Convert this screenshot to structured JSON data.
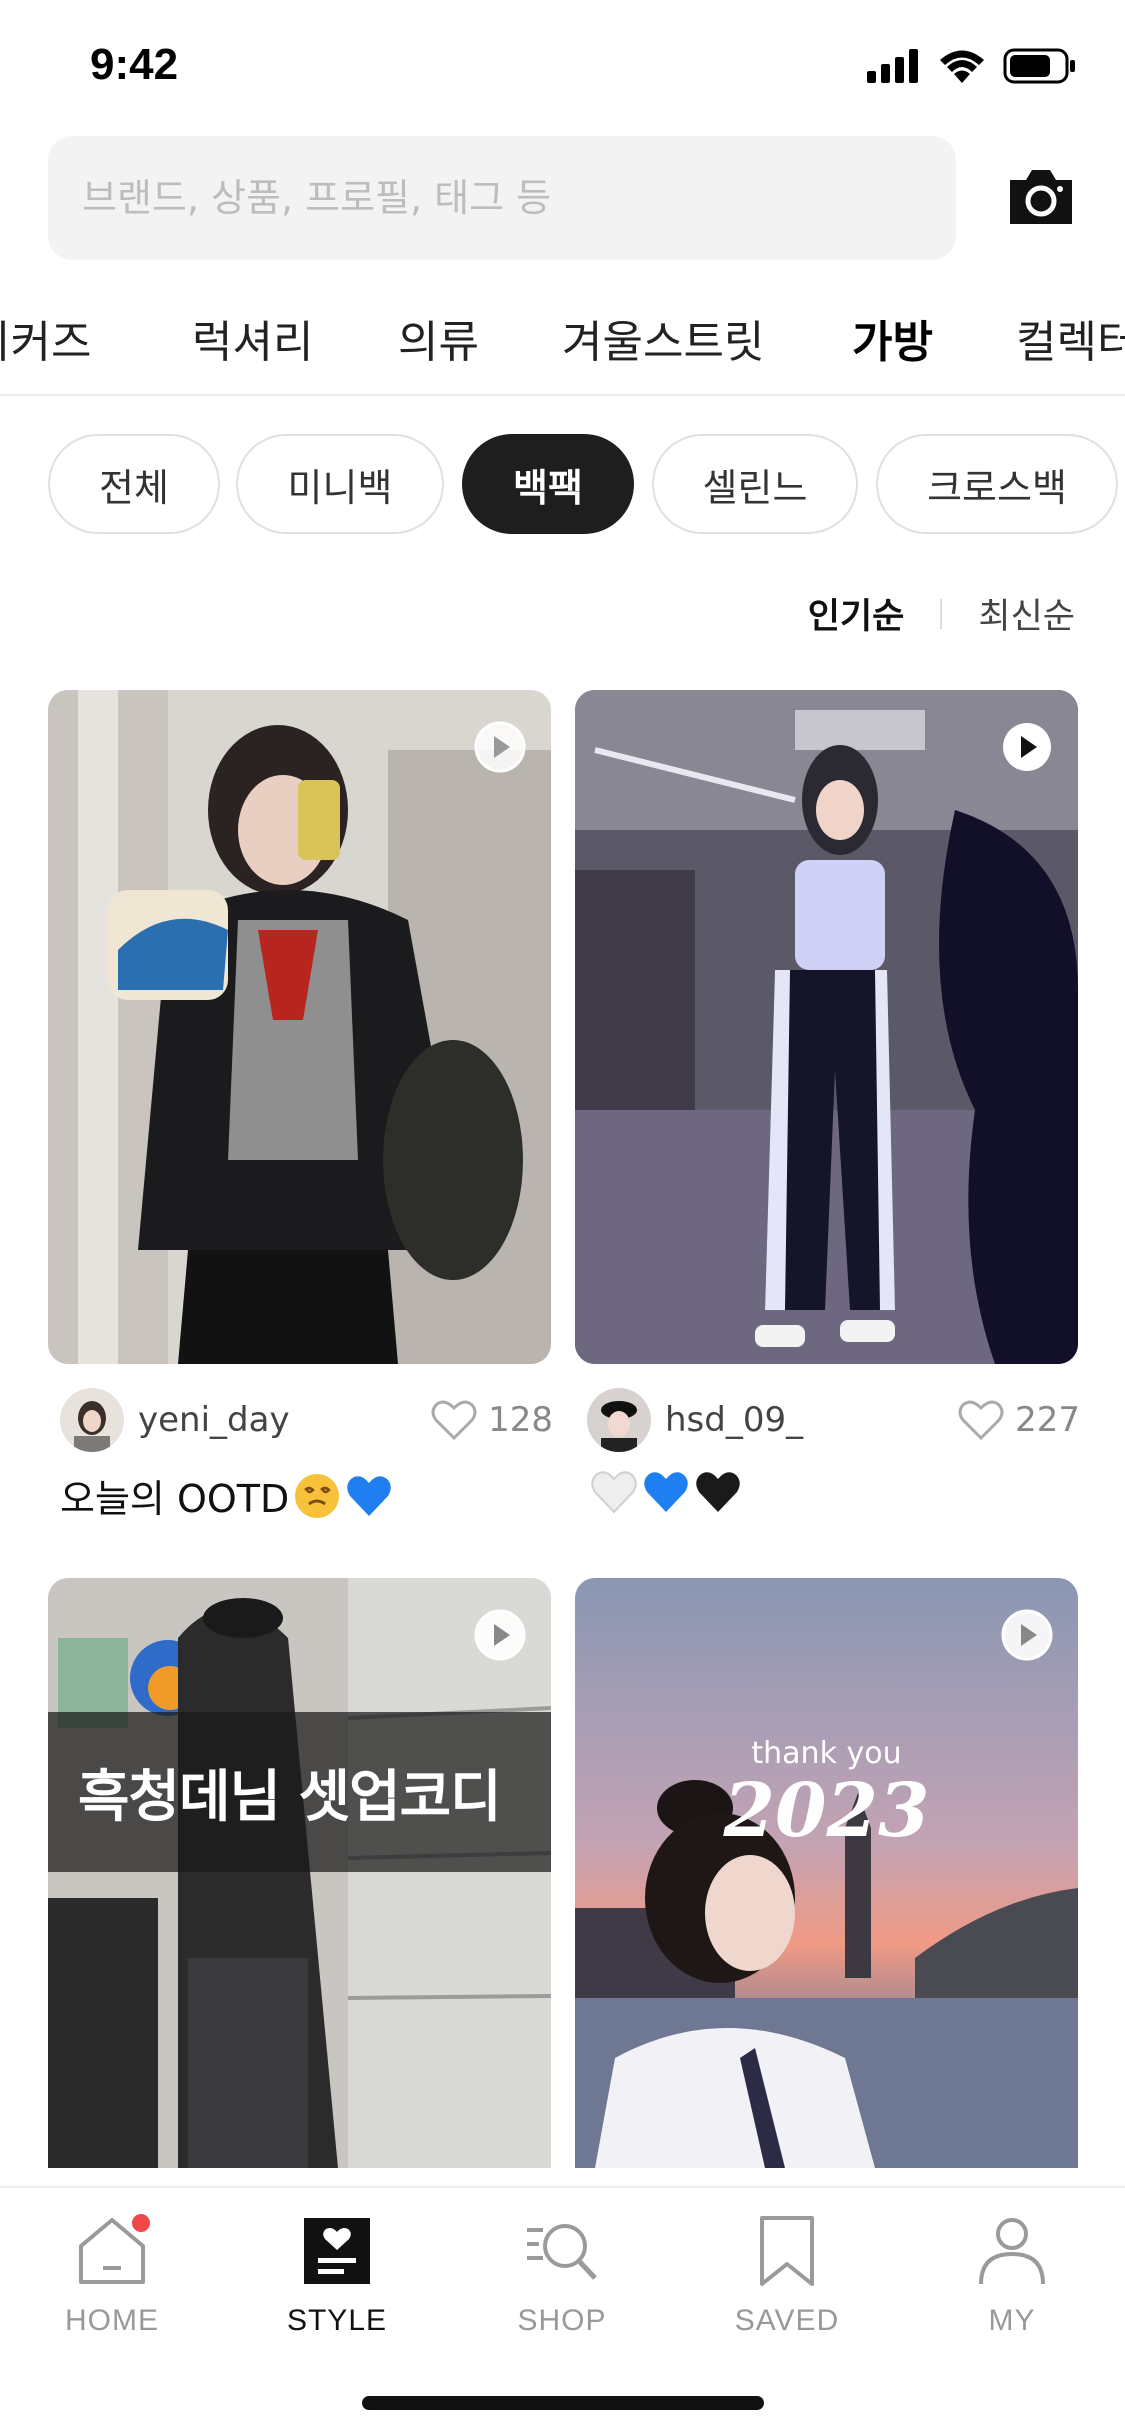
{
  "status_bar": {
    "time": "9:42"
  },
  "search": {
    "placeholder": "브랜드, 상품, 프로필, 태그 등",
    "camera_icon": "camera-icon"
  },
  "category_tabs": [
    {
      "label": "니커즈"
    },
    {
      "label": "럭셔리"
    },
    {
      "label": "의류"
    },
    {
      "label": "겨울스트릿"
    },
    {
      "label": "가방",
      "active": true
    },
    {
      "label": "컬렉터"
    }
  ],
  "filter_chips": [
    {
      "label": "전체"
    },
    {
      "label": "미니백"
    },
    {
      "label": "백팩",
      "active": true
    },
    {
      "label": "셀린느"
    },
    {
      "label": "크로스백"
    }
  ],
  "sort": {
    "popular": "인기순",
    "latest": "최신순",
    "selected": "인기순"
  },
  "feed": [
    {
      "username": "yeni_day",
      "likes": "128",
      "caption": "오늘의 OOTD",
      "caption_emojis": [
        "dizzy-face-emoji",
        "blue-heart-emoji"
      ],
      "has_video": true
    },
    {
      "username": "hsd_09_",
      "likes": "227",
      "caption": "",
      "caption_emojis": [
        "white-heart-emoji",
        "blue-heart-emoji",
        "black-heart-emoji"
      ],
      "has_video": true
    },
    {
      "overlay_text": "흑청데님 셋업코디",
      "has_video": true
    },
    {
      "overlay_small": "thank you",
      "overlay_year": "2023",
      "has_video": true
    }
  ],
  "bottom_nav": [
    {
      "label": "HOME",
      "icon": "home-icon",
      "badge": true
    },
    {
      "label": "STYLE",
      "icon": "style-icon",
      "active": true
    },
    {
      "label": "SHOP",
      "icon": "shop-icon"
    },
    {
      "label": "SAVED",
      "icon": "bookmark-icon"
    },
    {
      "label": "MY",
      "icon": "profile-icon"
    }
  ],
  "colors": {
    "accent_dark": "#1e1e1e",
    "badge_red": "#f04848",
    "muted_text": "#999999"
  }
}
